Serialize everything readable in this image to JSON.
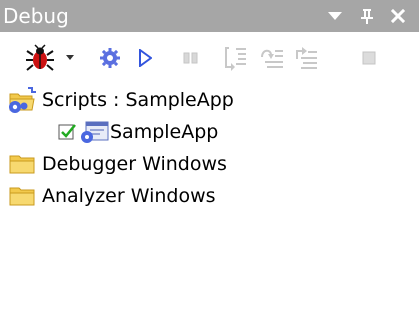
{
  "window": {
    "title": "Debug"
  },
  "colors": {
    "titlebar_bg": "#a6a6a6",
    "title_text": "#ffffff",
    "accent_blue": "#3355dd",
    "folder_yellow": "#f2c94c",
    "check_green": "#22aa22"
  },
  "toolbar": {
    "buttons": [
      {
        "name": "bug-icon",
        "enabled": true
      },
      {
        "name": "dropdown-arrow-icon",
        "enabled": true
      },
      {
        "name": "break-all-gear-icon",
        "enabled": true
      },
      {
        "name": "continue-play-icon",
        "enabled": true
      },
      {
        "name": "pause-icon",
        "enabled": false
      },
      {
        "name": "step-into-icon",
        "enabled": false
      },
      {
        "name": "step-over-icon",
        "enabled": false
      },
      {
        "name": "step-out-icon",
        "enabled": false
      },
      {
        "name": "stop-icon",
        "enabled": false
      }
    ]
  },
  "tree": {
    "scripts_label": "Scripts : SampleApp",
    "sampleapp_label": "SampleApp",
    "debugger_windows_label": "Debugger Windows",
    "analyzer_windows_label": "Analyzer Windows"
  }
}
